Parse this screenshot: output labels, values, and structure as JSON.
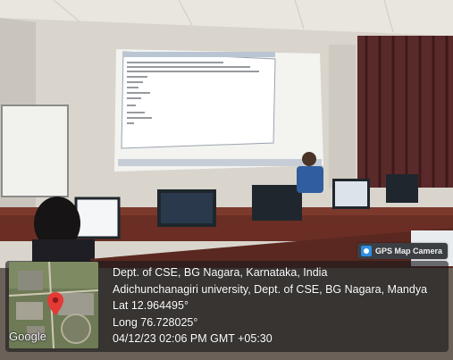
{
  "badge": {
    "label": "GPS Map Camera",
    "icon": "camera-icon"
  },
  "map": {
    "brand": "Google",
    "pin_icon": "map-pin-icon",
    "pin_color": "#e53935"
  },
  "geo": {
    "line1": "Dept. of CSE, BG Nagara, Karnataka, India",
    "line2": "Adichunchanagiri university, Dept. of CSE, BG Nagara, Mandya",
    "lat": "Lat 12.964495°",
    "long": "Long 76.728025°",
    "datetime": "04/12/23 02:06 PM GMT +05:30"
  },
  "colors": {
    "overlay": "#19191c",
    "badge_bg": "#3b3f43",
    "accent": "#2f8de4"
  }
}
